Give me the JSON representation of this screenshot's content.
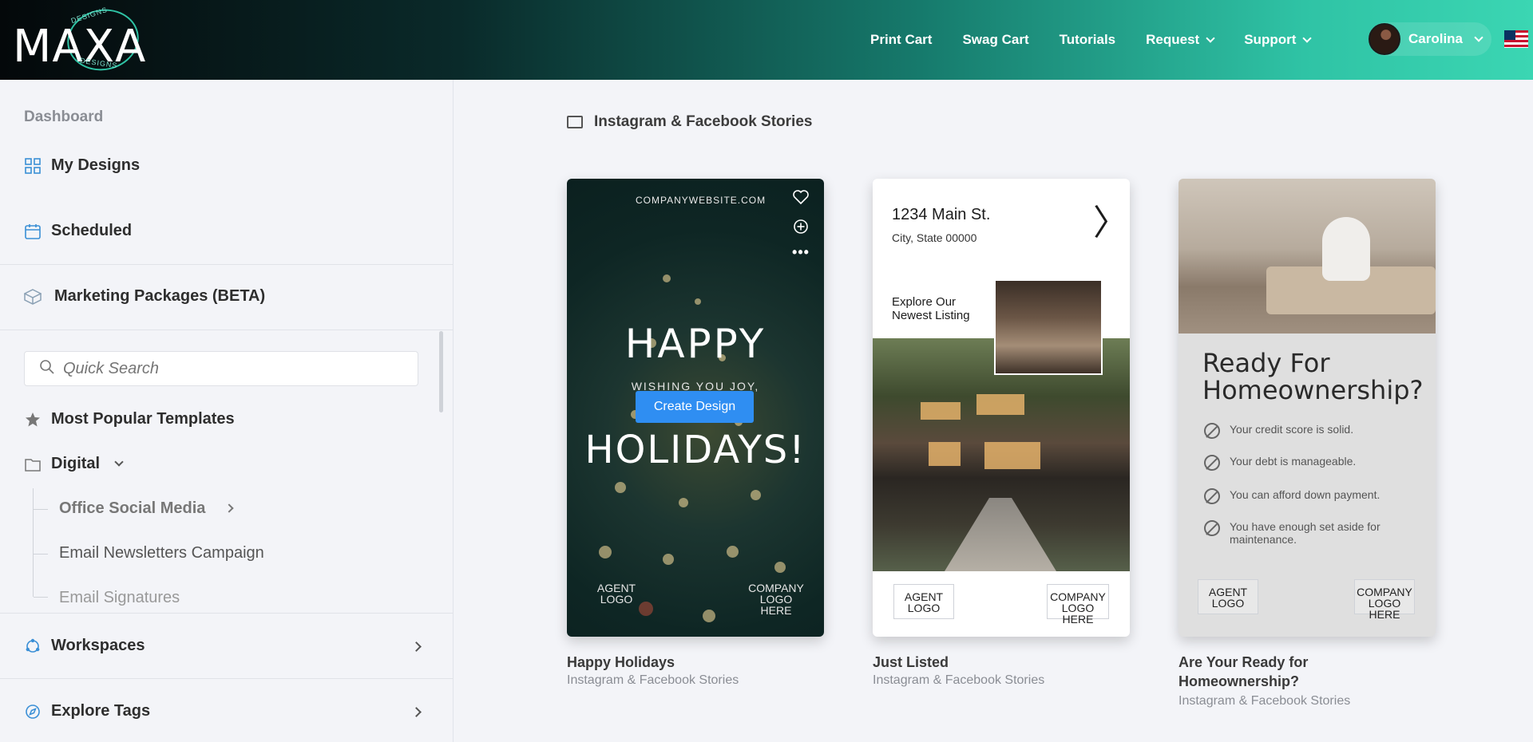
{
  "header": {
    "logo_text": "MAXA",
    "logo_tag": "DESIGNS",
    "nav": [
      "Print Cart",
      "Swag Cart",
      "Tutorials",
      "Request",
      "Support"
    ],
    "user_name": "Carolina"
  },
  "sidebar": {
    "dashboard": "Dashboard",
    "my_designs": "My Designs",
    "scheduled": "Scheduled",
    "marketing": "Marketing Packages (BETA)",
    "search_placeholder": "Quick Search",
    "popular": "Most Popular Templates",
    "digital": "Digital",
    "sub_items": [
      "Office Social Media",
      "Email Newsletters Campaign",
      "Email Signatures"
    ],
    "workspaces": "Workspaces",
    "explore_tags": "Explore Tags"
  },
  "main": {
    "breadcrumb": "Instagram & Facebook Stories",
    "cards": [
      {
        "title": "Happy Holidays",
        "subtitle": "Instagram & Facebook Stories",
        "site": "COMPANYWEBSITE.COM",
        "happy": "HAPPY",
        "wish": "WISHING YOU JOY,",
        "holidays": "HOLIDAYS!",
        "button": "Create Design",
        "agent": "AGENT",
        "agent2": "LOGO",
        "company": "COMPANY",
        "company2": "LOGO HERE"
      },
      {
        "title": "Just Listed",
        "subtitle": "Instagram & Facebook Stories",
        "address": "1234 Main St.",
        "city": "City, State 00000",
        "explore": "Explore Our Newest Listing",
        "agent": "AGENT",
        "agent2": "LOGO",
        "company": "COMPANY",
        "company2": "LOGO HERE"
      },
      {
        "title": "Are Your Ready for Homeownership?",
        "subtitle": "Instagram & Facebook Stories",
        "headline": "Ready For Homeownership?",
        "items": [
          "Your credit score is solid.",
          "Your debt is manageable.",
          "You can afford down payment.",
          "You have enough set aside for maintenance."
        ],
        "agent": "AGENT",
        "agent2": "LOGO",
        "company": "COMPANY",
        "company2": "LOGO HERE"
      }
    ]
  },
  "colors": {
    "accent": "#2f8ef2",
    "brand_teal": "#2fc3a5",
    "header_dark": "#04080a"
  },
  "icons": [
    "grid-icon",
    "calendar-icon",
    "box-icon",
    "search-icon",
    "star-icon",
    "folder-icon",
    "chevron-down-icon",
    "chevron-right-icon",
    "workspaces-icon",
    "compass-icon",
    "heart-icon",
    "plus-circle-icon",
    "more-icon",
    "flag-icon"
  ]
}
